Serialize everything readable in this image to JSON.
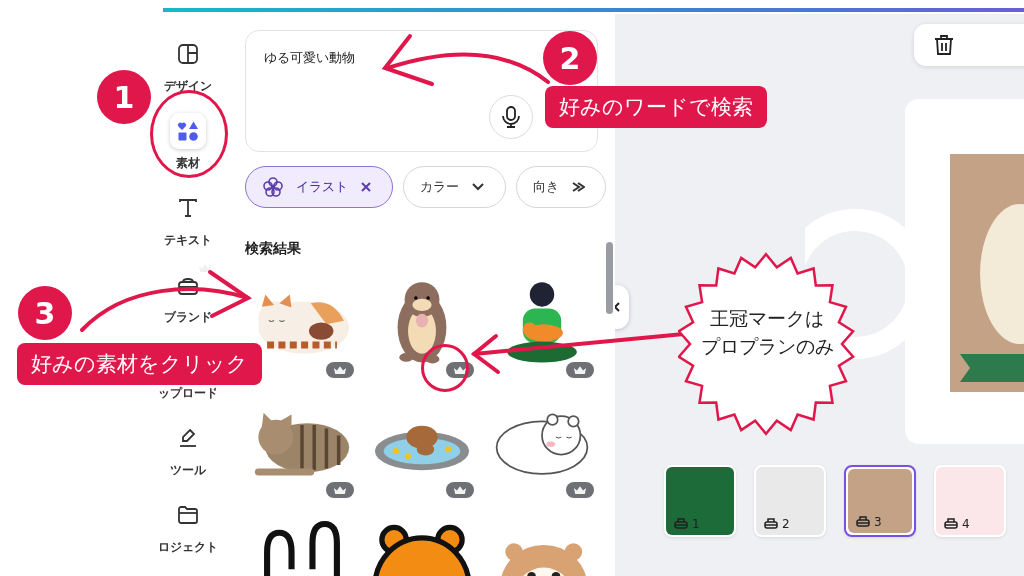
{
  "sidebar": {
    "items": [
      {
        "label": "デザイン",
        "selected": false,
        "pro": false
      },
      {
        "label": "素材",
        "selected": true,
        "pro": false
      },
      {
        "label": "テキスト",
        "selected": false,
        "pro": false
      },
      {
        "label": "ブランド",
        "selected": false,
        "pro": true
      },
      {
        "label": "ップロード",
        "selected": false,
        "pro": false
      },
      {
        "label": "ツール",
        "selected": false,
        "pro": false
      },
      {
        "label": "ロジェクト",
        "selected": false,
        "pro": false
      }
    ]
  },
  "search": {
    "value": "ゆる可愛い動物"
  },
  "filters": [
    {
      "label": "イラスト",
      "selected": true,
      "kind": "remove"
    },
    {
      "label": "カラー",
      "selected": false,
      "kind": "dropdown"
    },
    {
      "label": "向き",
      "selected": false,
      "kind": "more"
    }
  ],
  "results": {
    "heading": "検索結果",
    "items": [
      {
        "kind": "calico-cat",
        "pro": true
      },
      {
        "kind": "otter",
        "pro": true
      },
      {
        "kind": "person-cat",
        "pro": true
      },
      {
        "kind": "tabby-cat",
        "pro": true
      },
      {
        "kind": "capybara",
        "pro": true
      },
      {
        "kind": "polar-bear",
        "pro": true
      },
      {
        "kind": "rabbit",
        "pro": false
      },
      {
        "kind": "bear",
        "pro": false
      },
      {
        "kind": "hamster",
        "pro": false
      }
    ]
  },
  "canvas": {
    "pages": [
      {
        "number": "1",
        "selected": false
      },
      {
        "number": "2",
        "selected": false
      },
      {
        "number": "3",
        "selected": true
      },
      {
        "number": "4",
        "selected": false
      }
    ]
  },
  "annotations": {
    "steps": [
      {
        "number": "1"
      },
      {
        "number": "2",
        "caption": "好みのワードで検索"
      },
      {
        "number": "3",
        "caption": "好みの素材をクリック"
      }
    ],
    "callout": {
      "lines": [
        "王冠マークは",
        "プロプランのみ"
      ]
    }
  }
}
